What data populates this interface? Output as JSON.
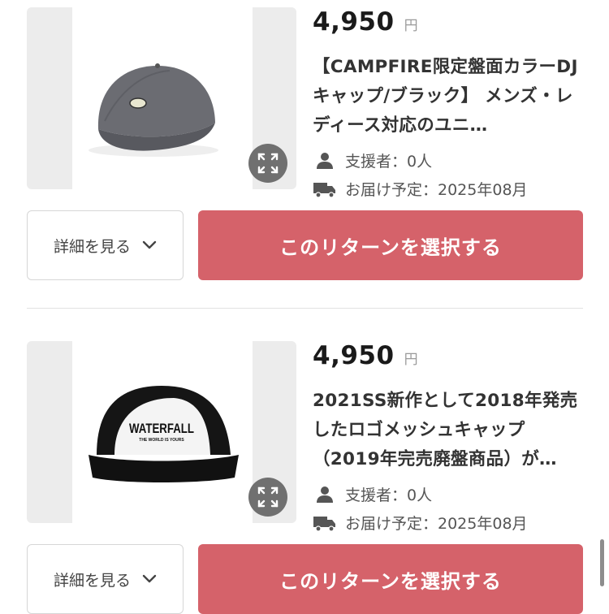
{
  "rewards": [
    {
      "price": "4,950",
      "currency": "円",
      "title": "【CAMPFIRE限定盤面カラーDJキャップ/ブラック】 メンズ・レディース対応のユニ…",
      "supporters": "支援者：0人",
      "delivery": "お届け予定：2025年08月",
      "detail_label": "詳細を見る",
      "select_label": "このリターンを選択する",
      "image_icon": "gray-cap-image"
    },
    {
      "price": "4,950",
      "currency": "円",
      "title": "2021SS新作として2018年発売したロゴメッシュキャップ（2019年完売廃盤商品）が…",
      "supporters": "支援者：0人",
      "delivery": "お届け予定：2025年08月",
      "detail_label": "詳細を見る",
      "select_label": "このリターンを選択する",
      "image_icon": "mesh-cap-image",
      "cap_logo": "WATERFALL",
      "cap_tagline": "THE WORLD IS YOURS"
    }
  ],
  "colors": {
    "accent": "#d5626a",
    "text": "#333333",
    "muted": "#555555"
  },
  "icons": [
    "expand-icon",
    "person-icon",
    "truck-icon",
    "chevron-down-icon"
  ]
}
